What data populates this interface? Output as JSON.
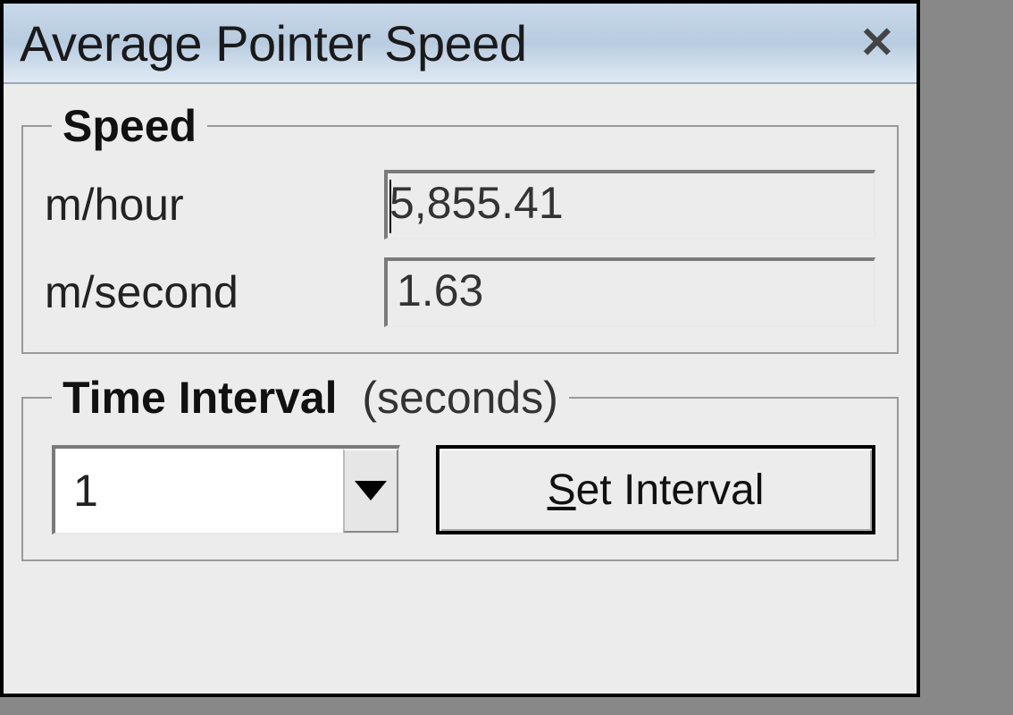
{
  "window": {
    "title": "Average Pointer Speed"
  },
  "speed_group": {
    "legend": "Speed",
    "m_per_hour_label": "m/hour",
    "m_per_hour_value": "5,855.41",
    "m_per_second_label": "m/second",
    "m_per_second_value": "1.63"
  },
  "interval_group": {
    "legend_bold": "Time Interval",
    "legend_suffix": "(seconds)",
    "interval_value": "1",
    "set_button_prefix": "S",
    "set_button_rest": "et Interval"
  }
}
